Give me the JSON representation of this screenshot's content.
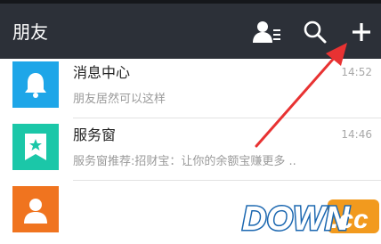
{
  "header": {
    "title": "朋友",
    "icons": [
      "contacts-icon",
      "search-icon",
      "add-icon"
    ]
  },
  "conversations": [
    {
      "name": "消息中心",
      "snippet": "朋友居然可以这样",
      "time": "14:52",
      "icon": "bell-icon",
      "color": "#1ea6e8"
    },
    {
      "name": "服务窗",
      "snippet": "服务窗推荐:招财宝：让你的余额宝赚更多 ..",
      "time": "14:46",
      "icon": "star-bookmark-icon",
      "color": "#1bc7a8"
    },
    {
      "icon": "person-icon",
      "color": "#f0741f"
    }
  ],
  "watermark": {
    "text": "DOWN",
    "suffix": ".cc"
  },
  "colors": {
    "header_bg": "#2c3038",
    "arrow": "#e83232"
  }
}
